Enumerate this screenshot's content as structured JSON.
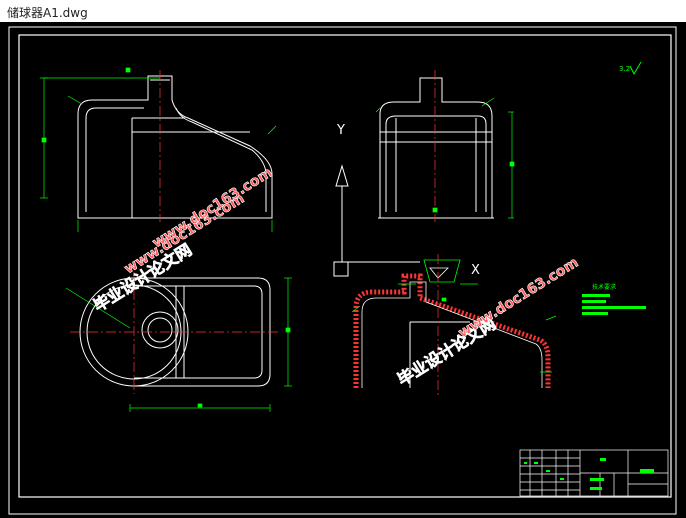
{
  "window": {
    "title": "储球器A1.dwg"
  },
  "drawing": {
    "roughness": "3.2",
    "axis_labels": {
      "y": "Y",
      "x": "X"
    },
    "tech_req_title": "技术要求",
    "watermark": {
      "cn": "毕业设计论文网",
      "url": "www.doc163.com"
    }
  },
  "colors": {
    "background": "#000000",
    "outline": "#ffffff",
    "dimension": "#00ff00",
    "centerline": "#ff3333",
    "watermark": "#ff5a5a"
  }
}
